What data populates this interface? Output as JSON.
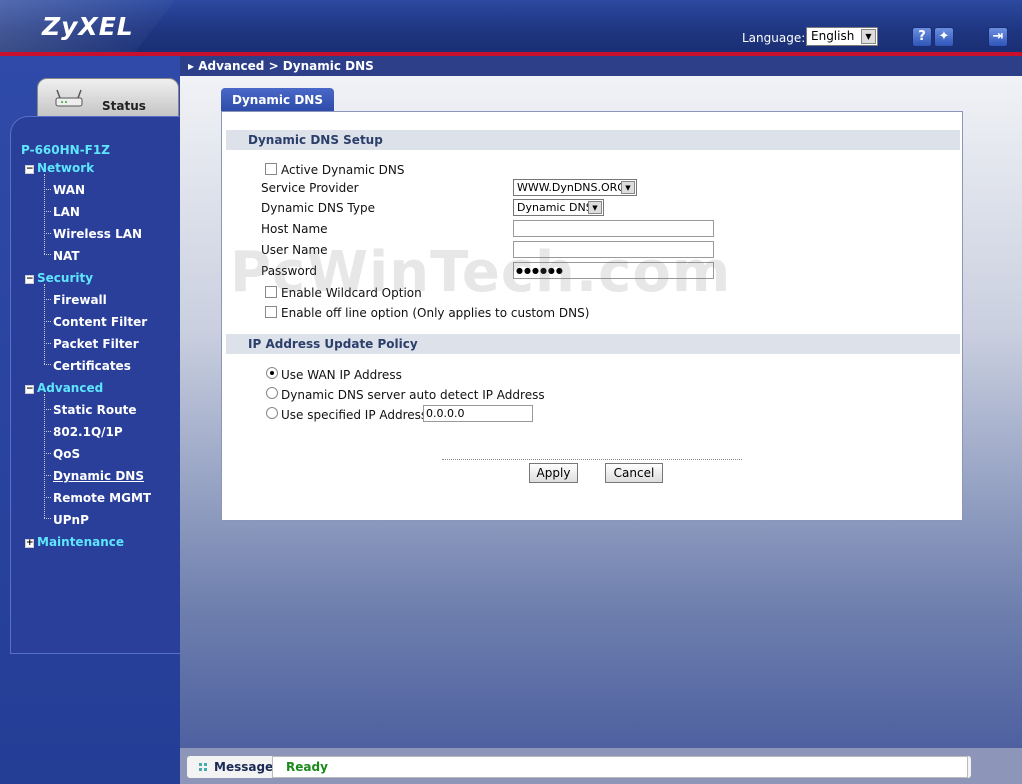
{
  "header": {
    "logo": "ZyXEL",
    "language_label": "Language:",
    "language_value": "English",
    "help_icon": "?",
    "wizard_icon": "wizard-icon",
    "logout_icon": "logout-icon"
  },
  "sidebar": {
    "status_label": "Status",
    "device_name": "P-660HN-F1Z",
    "groups": [
      {
        "label": "Network",
        "items": [
          "WAN",
          "LAN",
          "Wireless LAN",
          "NAT"
        ]
      },
      {
        "label": "Security",
        "items": [
          "Firewall",
          "Content Filter",
          "Packet Filter",
          "Certificates"
        ]
      },
      {
        "label": "Advanced",
        "items": [
          "Static Route",
          "802.1Q/1P",
          "QoS",
          "Dynamic DNS",
          "Remote MGMT",
          "UPnP"
        ]
      },
      {
        "label": "Maintenance",
        "items": []
      }
    ],
    "active_item": "Dynamic DNS"
  },
  "breadcrumb": "Advanced > Dynamic DNS",
  "tab_label": "Dynamic DNS",
  "setup": {
    "title": "Dynamic DNS Setup",
    "active_label": "Active Dynamic DNS",
    "active_checked": false,
    "service_provider_label": "Service Provider",
    "service_provider_value": "WWW.DynDNS.ORG",
    "ddns_type_label": "Dynamic DNS Type",
    "ddns_type_value": "Dynamic DNS",
    "host_name_label": "Host Name",
    "host_name_value": "",
    "user_name_label": "User Name",
    "user_name_value": "",
    "password_label": "Password",
    "password_value": "●●●●●●",
    "wildcard_label": "Enable Wildcard Option",
    "wildcard_checked": false,
    "offline_label": "Enable off line option (Only applies to custom DNS)",
    "offline_checked": false
  },
  "policy": {
    "title": "IP Address Update Policy",
    "options": [
      {
        "label": "Use WAN IP Address",
        "selected": true
      },
      {
        "label": "Dynamic DNS server auto detect IP Address",
        "selected": false
      },
      {
        "label": "Use specified IP Address",
        "selected": false
      }
    ],
    "specified_ip_value": "0.0.0.0"
  },
  "buttons": {
    "apply": "Apply",
    "cancel": "Cancel"
  },
  "watermark": "PcWinTech.com",
  "footer": {
    "message_label": "Message",
    "status": "Ready"
  },
  "colors": {
    "accent_red": "#c8102e",
    "nav_cyan": "#5fe6ff",
    "status_green": "#1a8a1a"
  }
}
